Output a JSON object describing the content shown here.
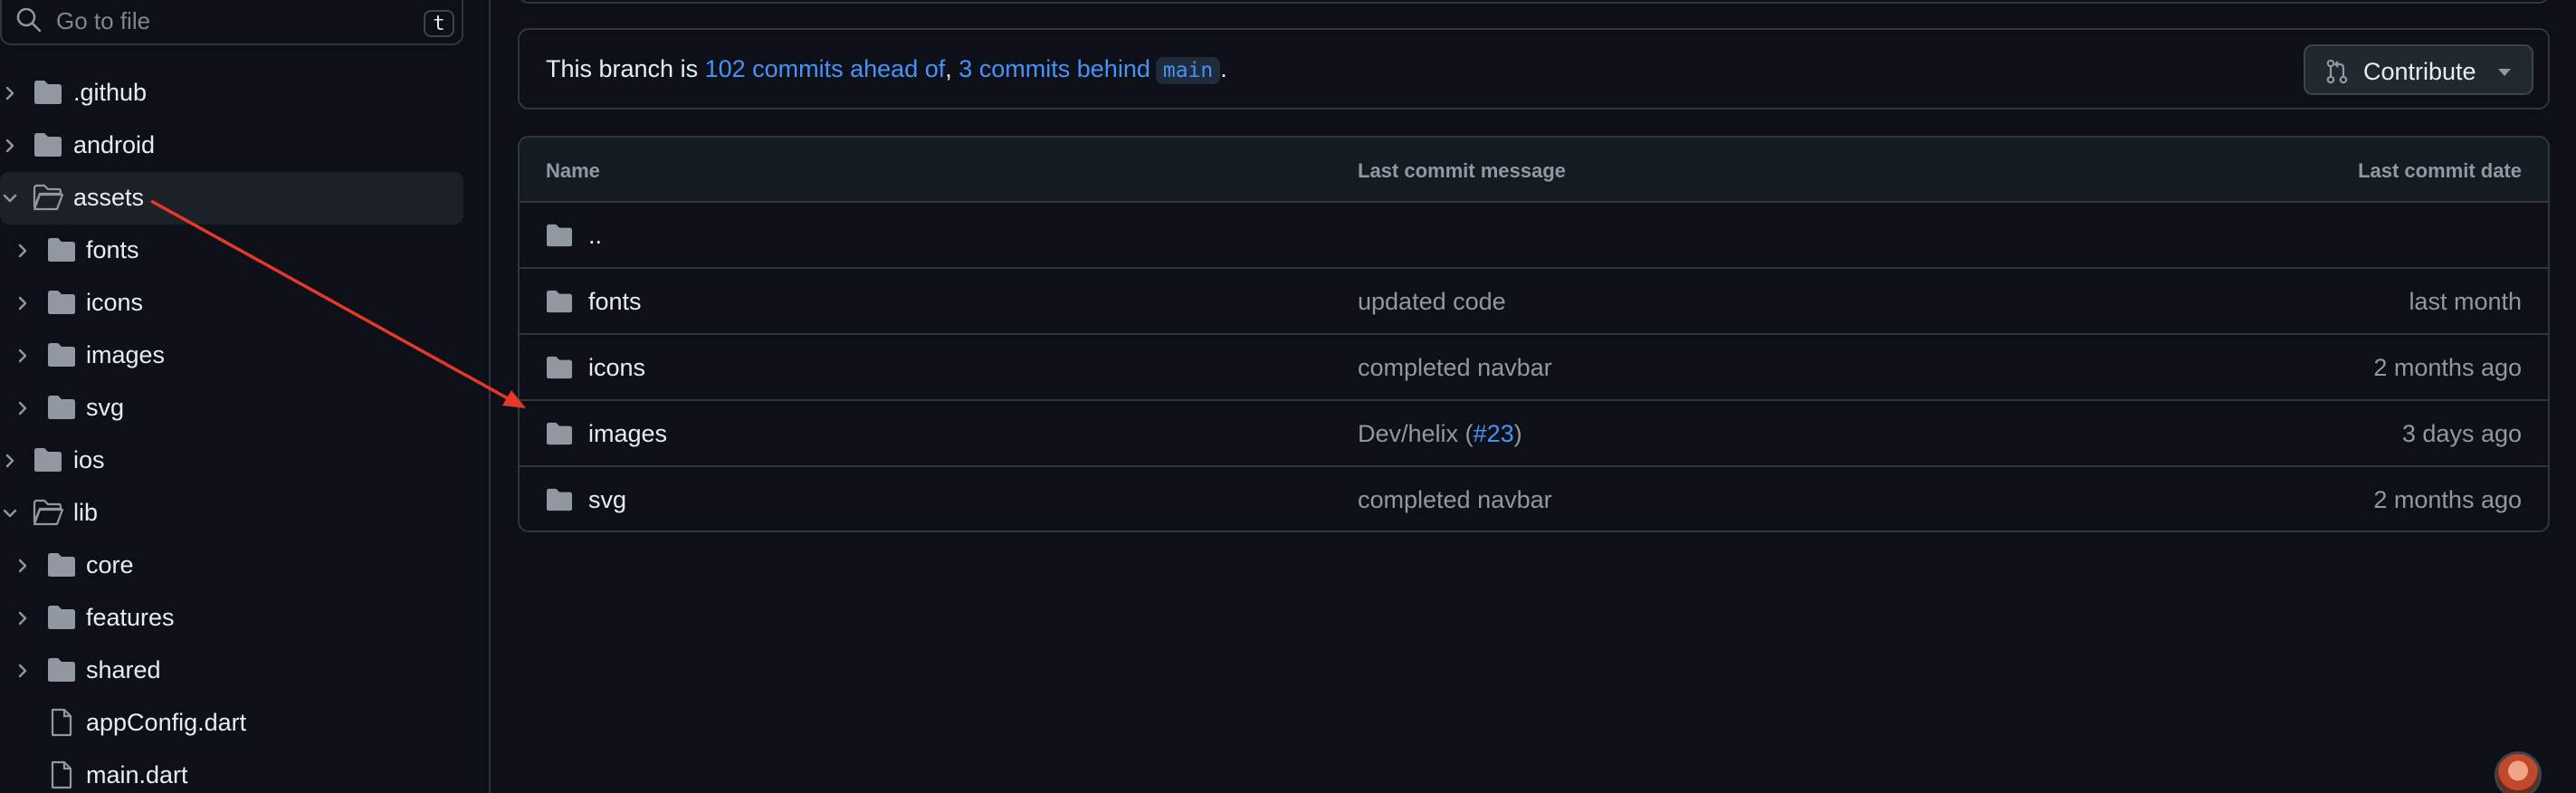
{
  "sidebar": {
    "search": {
      "placeholder": "Go to file",
      "shortcut": "t"
    },
    "items": [
      {
        "label": ".github",
        "type": "folder",
        "level": 0,
        "expanded": false
      },
      {
        "label": "android",
        "type": "folder",
        "level": 0,
        "expanded": false
      },
      {
        "label": "assets",
        "type": "folder",
        "level": 0,
        "expanded": true,
        "selected": true
      },
      {
        "label": "fonts",
        "type": "folder",
        "level": 1,
        "expanded": false
      },
      {
        "label": "icons",
        "type": "folder",
        "level": 1,
        "expanded": false
      },
      {
        "label": "images",
        "type": "folder",
        "level": 1,
        "expanded": false
      },
      {
        "label": "svg",
        "type": "folder",
        "level": 1,
        "expanded": false
      },
      {
        "label": "ios",
        "type": "folder",
        "level": 0,
        "expanded": false
      },
      {
        "label": "lib",
        "type": "folder",
        "level": 0,
        "expanded": true
      },
      {
        "label": "core",
        "type": "folder",
        "level": 1,
        "expanded": false
      },
      {
        "label": "features",
        "type": "folder",
        "level": 1,
        "expanded": false
      },
      {
        "label": "shared",
        "type": "folder",
        "level": 1,
        "expanded": false
      },
      {
        "label": "appConfig.dart",
        "type": "file",
        "level": 1
      },
      {
        "label": "main.dart",
        "type": "file",
        "level": 1
      }
    ]
  },
  "branch": {
    "prefix": "This branch is ",
    "ahead": "102 commits ahead of",
    "separator": ", ",
    "behind": "3 commits behind",
    "base": "main",
    "suffix": ".",
    "contribute_label": "Contribute"
  },
  "table": {
    "headers": {
      "name": "Name",
      "message": "Last commit message",
      "date": "Last commit date"
    },
    "rows": [
      {
        "name": "..",
        "message": "",
        "date": ""
      },
      {
        "name": "fonts",
        "message": "updated code",
        "date": "last month"
      },
      {
        "name": "icons",
        "message": "completed navbar",
        "date": "2 months ago"
      },
      {
        "name": "images",
        "message": "Dev/helix (",
        "message_link": "#23",
        "message_suffix": ")",
        "date": "3 days ago"
      },
      {
        "name": "svg",
        "message": "completed navbar",
        "date": "2 months ago"
      }
    ]
  },
  "colors": {
    "background": "#0d1117",
    "border": "#30363d",
    "link": "#4493f8",
    "muted": "#9198a1",
    "annotation_arrow": "#e5382a"
  },
  "icons": {
    "search": "search-icon",
    "folder": "folder-icon",
    "file": "file-icon",
    "chevron": "chevron-right-icon",
    "pull_request": "git-pull-request-icon",
    "caret": "caret-down-icon"
  }
}
